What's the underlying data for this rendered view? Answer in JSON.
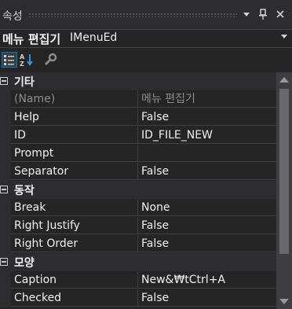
{
  "window": {
    "title": "속성",
    "dropdown_icon": "chevron-down-icon",
    "pin_icon": "pin-icon",
    "close_icon": "close-icon"
  },
  "object_selector": {
    "name": "메뉴 편집기",
    "type": "IMenuEd",
    "caret_icon": "chevron-down-icon"
  },
  "toolbar": {
    "buttons": [
      {
        "name": "categorized-icon",
        "active": true
      },
      {
        "name": "alphabetical-icon",
        "active": false
      },
      {
        "name": "property-pages-icon",
        "active": false
      }
    ]
  },
  "categories": [
    {
      "label": "기타",
      "properties": [
        {
          "name": "(Name)",
          "value": "메뉴 편집기",
          "disabled": true
        },
        {
          "name": "Help",
          "value": "False"
        },
        {
          "name": "ID",
          "value": "ID_FILE_NEW"
        },
        {
          "name": "Prompt",
          "value": ""
        },
        {
          "name": "Separator",
          "value": "False"
        }
      ]
    },
    {
      "label": "동작",
      "properties": [
        {
          "name": "Break",
          "value": "None"
        },
        {
          "name": "Right Justify",
          "value": "False"
        },
        {
          "name": "Right Order",
          "value": "False"
        }
      ]
    },
    {
      "label": "모양",
      "properties": [
        {
          "name": "Caption",
          "value": "New&₩tCtrl+A"
        },
        {
          "name": "Checked",
          "value": "False"
        }
      ]
    }
  ],
  "colors": {
    "background": "#252526",
    "accent": "#007acc",
    "grid_line": "#3f3f46"
  }
}
